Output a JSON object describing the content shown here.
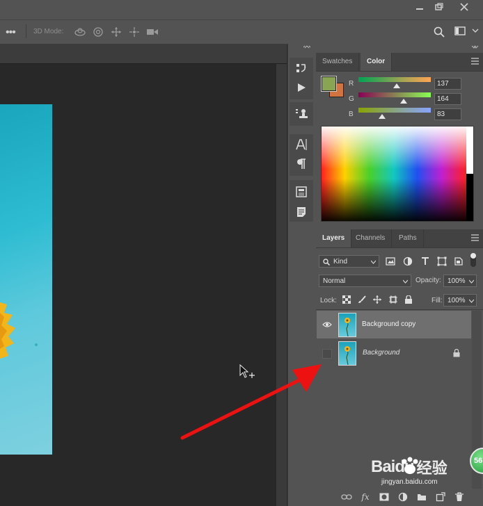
{
  "options_bar": {
    "mode_label": "3D Mode:"
  },
  "color_panel": {
    "tabs": [
      "Swatches",
      "Color"
    ],
    "active_tab": "Color",
    "foreground": "#89a453",
    "background": "#d2743f",
    "channels": [
      {
        "label": "R",
        "value": "137"
      },
      {
        "label": "G",
        "value": "164"
      },
      {
        "label": "B",
        "value": "83"
      }
    ]
  },
  "layers_panel": {
    "tabs": [
      "Layers",
      "Channels",
      "Paths"
    ],
    "active_tab": "Layers",
    "filter_kind": "Kind",
    "blend_mode": "Normal",
    "opacity_label": "Opacity:",
    "opacity_value": "100%",
    "lock_label": "Lock:",
    "fill_label": "Fill:",
    "fill_value": "100%",
    "layers": [
      {
        "name": "Background copy",
        "visible": true,
        "selected": true,
        "locked": false
      },
      {
        "name": "Background",
        "visible": false,
        "selected": false,
        "locked": true
      }
    ]
  },
  "watermark": {
    "brand": "Baidu",
    "brand_cn": "经验",
    "url": "jingyan.baidu.com",
    "badge": "56"
  },
  "colors": {
    "annotation_arrow": "#ee1111",
    "panel_bg": "#535353",
    "canvas_bg": "#282828"
  }
}
